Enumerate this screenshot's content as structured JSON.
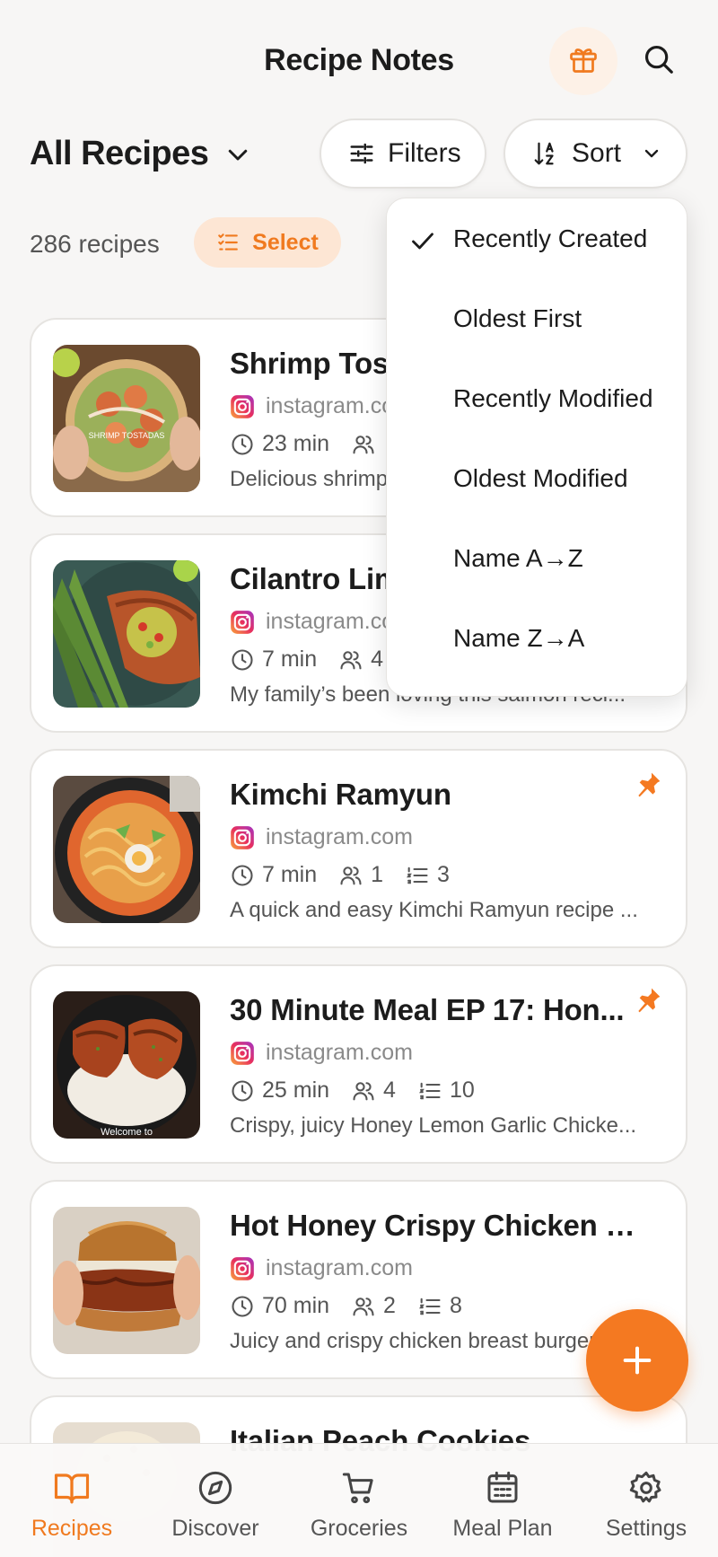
{
  "header": {
    "title": "Recipe Notes"
  },
  "toolbar": {
    "collection": "All Recipes",
    "filters_label": "Filters",
    "sort_label": "Sort"
  },
  "summary": {
    "count": "286 recipes",
    "select_label": "Select"
  },
  "sort_menu": {
    "selected": "Recently Created",
    "options": [
      {
        "label": "Recently Created"
      },
      {
        "label": "Oldest First"
      },
      {
        "label": "Recently Modified"
      },
      {
        "label": "Oldest Modified"
      },
      {
        "label": "Name A→Z"
      },
      {
        "label": "Name Z→A"
      }
    ]
  },
  "recipes": [
    {
      "title": "Shrimp Tostadas",
      "source": "instagram.com",
      "time": "23 min",
      "servings": "",
      "steps": "",
      "description": "Delicious shrimp tostadas",
      "pinned": false,
      "thumb_text": "SHRIMP TOSTADAS"
    },
    {
      "title": "Cilantro Lime Salmon",
      "source": "instagram.com",
      "time": "7 min",
      "servings": "4",
      "steps": "",
      "description": "My family’s been loving this salmon reci...",
      "pinned": false
    },
    {
      "title": "Kimchi Ramyun",
      "source": "instagram.com",
      "time": "7 min",
      "servings": "1",
      "steps": "3",
      "description": "A quick and easy Kimchi Ramyun recipe ...",
      "pinned": true
    },
    {
      "title": "30 Minute Meal EP 17: Hon...",
      "source": "instagram.com",
      "time": "25 min",
      "servings": "4",
      "steps": "10",
      "description": "Crispy, juicy Honey Lemon Garlic Chicke...",
      "pinned": true,
      "thumb_text": "Welcome to"
    },
    {
      "title": "Hot Honey Crispy Chicken Bu...",
      "source": "instagram.com",
      "time": "70 min",
      "servings": "2",
      "steps": "8",
      "description": "Juicy and crispy chicken breast burgers",
      "pinned": false
    },
    {
      "title": "Italian Peach Cookies"
    }
  ],
  "tabs": [
    {
      "label": "Recipes",
      "icon": "book-icon"
    },
    {
      "label": "Discover",
      "icon": "compass-icon"
    },
    {
      "label": "Groceries",
      "icon": "cart-icon"
    },
    {
      "label": "Meal Plan",
      "icon": "calendar-icon"
    },
    {
      "label": "Settings",
      "icon": "gear-icon"
    }
  ],
  "colors": {
    "accent": "#f47921",
    "accent_light": "#fde6d4",
    "background": "#f7f6f5"
  }
}
